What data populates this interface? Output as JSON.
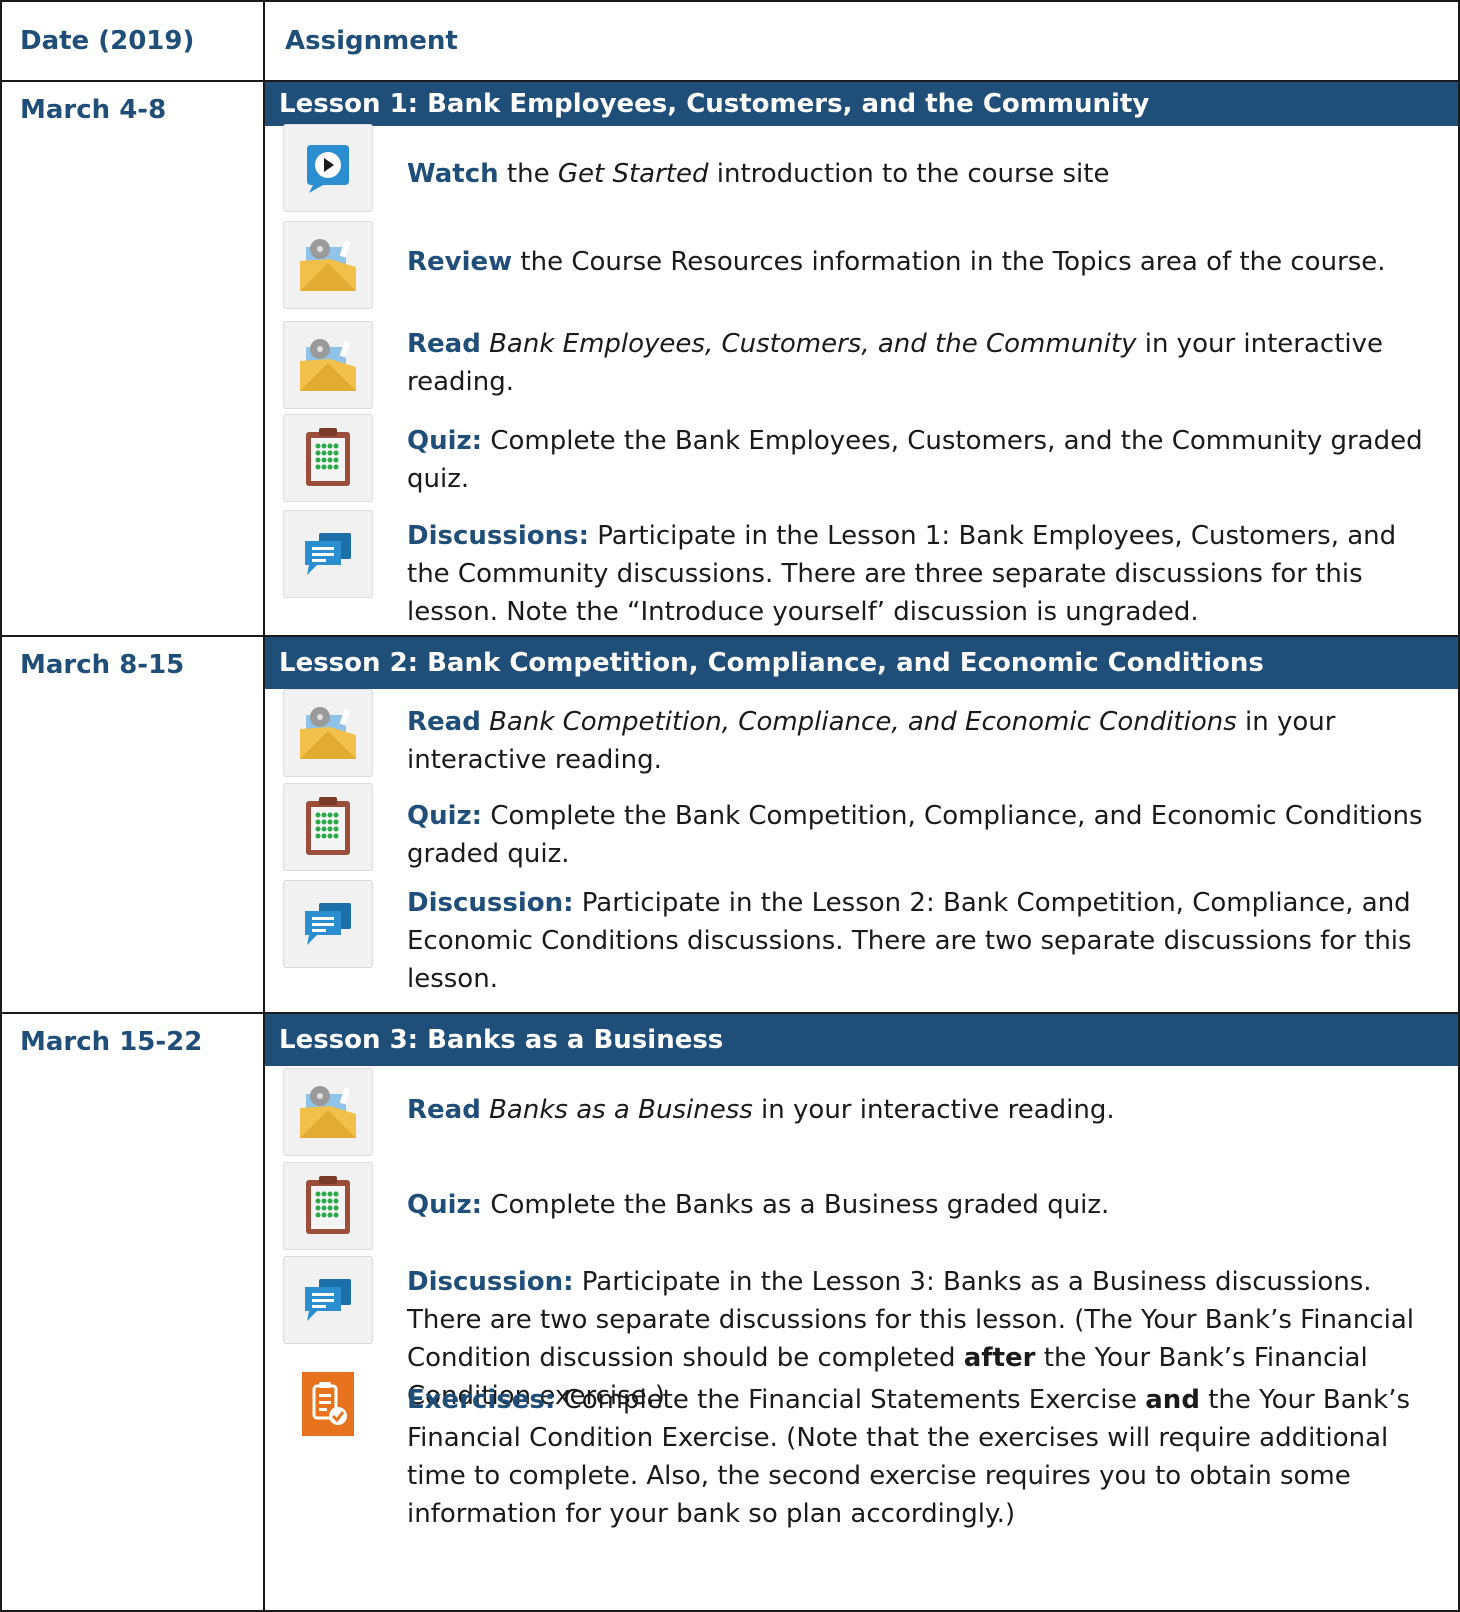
{
  "header": {
    "date_label": "Date (2019)",
    "assignment_label": "Assignment"
  },
  "lessons": [
    {
      "date": "March 4-8",
      "title": "Lesson 1: Bank Employees, Customers, and the Community",
      "tasks": [
        {
          "icon": "video-icon",
          "verb": "Watch",
          "t1": " the ",
          "em": "Get Started",
          "t2": " introduction to the course site"
        },
        {
          "icon": "folder-icon",
          "verb": "Review",
          "t1": " the Course Resources information in the Topics area of the course.",
          "em": "",
          "t2": ""
        },
        {
          "icon": "folder-icon",
          "verb": "Read",
          "t1": " ",
          "em": "Bank Employees, Customers, and the Community",
          "t2": " in your interactive reading."
        },
        {
          "icon": "quiz-clipboard-icon",
          "verb": "Quiz:",
          "t1": " Complete the Bank Employees, Customers, and the Community graded quiz.",
          "em": "",
          "t2": ""
        },
        {
          "icon": "discussion-icon",
          "verb": "Discussions:",
          "t1": " Participate in the Lesson 1: Bank Employees, Customers, and the Community discussions. There are three separate discussions for this lesson. Note the “Introduce yourself’ discussion is ungraded.",
          "em": "",
          "t2": ""
        }
      ]
    },
    {
      "date": "March 8-15",
      "title": "Lesson 2: Bank Competition, Compliance, and Economic Conditions",
      "tasks": [
        {
          "icon": "folder-icon",
          "verb": "Read",
          "t1": " ",
          "em": "Bank Competition, Compliance, and Economic Conditions",
          "t2": " in your interactive reading."
        },
        {
          "icon": "quiz-clipboard-icon",
          "verb": "Quiz:",
          "t1": " Complete the Bank Competition, Compliance, and Economic Conditions graded quiz.",
          "em": "",
          "t2": ""
        },
        {
          "icon": "discussion-icon",
          "verb": "Discussion:",
          "t1": " Participate in the Lesson 2: Bank Competition, Compliance, and Economic Conditions discussions. There are two separate discussions for this lesson.",
          "em": "",
          "t2": ""
        }
      ]
    },
    {
      "date": "March 15-22",
      "title": "Lesson 3: Banks as a Business",
      "tasks": [
        {
          "icon": "folder-icon",
          "verb": "Read",
          "t1": " ",
          "em": "Banks as a Business",
          "t2": " in your interactive reading."
        },
        {
          "icon": "quiz-clipboard-icon",
          "verb": "Quiz:",
          "t1": " Complete the Banks as a Business graded quiz.",
          "em": "",
          "t2": ""
        },
        {
          "icon": "discussion-icon",
          "verb": "Discussion:",
          "t1": " Participate in the Lesson 3: Banks as a Business discussions. There are two separate discussions for this lesson. (The Your Bank’s Financial Condition discussion should be completed ",
          "b": "after",
          "t3": " the Your Bank’s Financial Condition exercise.)"
        },
        {
          "icon": "exercise-checklist-icon",
          "verb": "Exercises:",
          "t1": " Complete the Financial Statements Exercise ",
          "b": "and",
          "t3": " the Your Bank’s Financial Condition Exercise. (Note that the exercises will require additional time to complete. Also, the second exercise requires you to obtain some information for your bank so plan accordingly.)"
        }
      ]
    }
  ],
  "colors": {
    "accent": "#1f4e79",
    "lesson_bar": "#1f4e79",
    "exercise_icon": "#e8731f",
    "discussion_icon": "#2a8ed1"
  }
}
